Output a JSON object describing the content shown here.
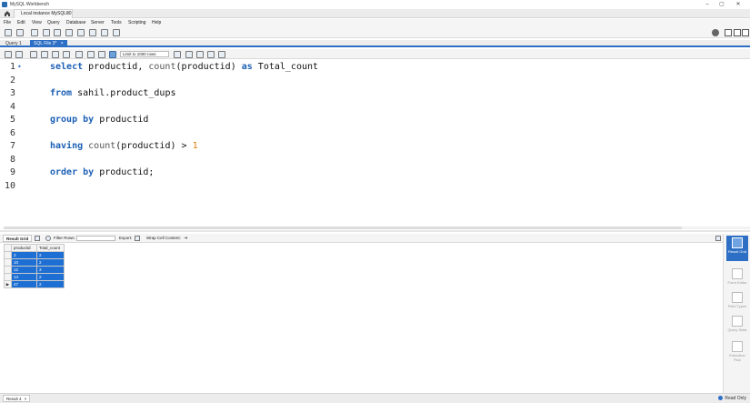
{
  "window": {
    "title": "MySQL Workbench",
    "controls": [
      "–",
      "▢",
      "✕"
    ]
  },
  "connection_tab": {
    "label": "Local instance MySQL80",
    "close": "×"
  },
  "menu": [
    "File",
    "Edit",
    "View",
    "Query",
    "Database",
    "Server",
    "Tools",
    "Scripting",
    "Help"
  ],
  "file_tabs": [
    {
      "label": "Query 1"
    },
    {
      "label": "SQL File 3*",
      "close": "×"
    }
  ],
  "limit_select": "Limit to 1000 rows",
  "editor": {
    "line_numbers": [
      "1",
      "2",
      "3",
      "4",
      "5",
      "6",
      "7",
      "8",
      "9",
      "10"
    ],
    "line1_marker": "•",
    "code": {
      "l1_kw1": "select",
      "l1_t1": " productid, ",
      "l1_fn": "count",
      "l1_t2": "(productid) ",
      "l1_kw2": "as",
      "l1_t3": " Total_count",
      "l3_kw": "from",
      "l3_t": " sahil.product_dups",
      "l5_kw": "group by",
      "l5_t": " productid",
      "l7_kw": "having",
      "l7_sp": " ",
      "l7_fn": "count",
      "l7_t": "(productid) > ",
      "l7_num": "1",
      "l9_kw": "order by",
      "l9_t": " productid;"
    }
  },
  "result_toolbar": {
    "result_grid_tab": "Result Grid",
    "filter_label": "Filter Rows:",
    "filter_value": "",
    "export_label": "Export:",
    "wrap_label": "Wrap Cell Content:"
  },
  "result_grid": {
    "columns": [
      "productid",
      "Total_count"
    ],
    "rows": [
      [
        "3",
        "2"
      ],
      [
        "10",
        "2"
      ],
      [
        "12",
        "3"
      ],
      [
        "14",
        "2"
      ],
      [
        "47",
        "2"
      ]
    ],
    "current_row_marker": "▶"
  },
  "side_panel": [
    {
      "label": "Result Grid",
      "active": true
    },
    {
      "label": "Form Editor",
      "active": false
    },
    {
      "label": "Field Types",
      "active": false
    },
    {
      "label": "Query Stats",
      "active": false
    },
    {
      "label": "Execution Plan",
      "active": false
    }
  ],
  "status_bar": {
    "result_tab": "Result 4",
    "result_tab_close": "×",
    "read_only": "Read Only"
  },
  "colors": {
    "accent": "#2d6fc4",
    "selection": "#1e6fd3",
    "keyword": "#1b5fb5",
    "number": "#e07a00"
  }
}
